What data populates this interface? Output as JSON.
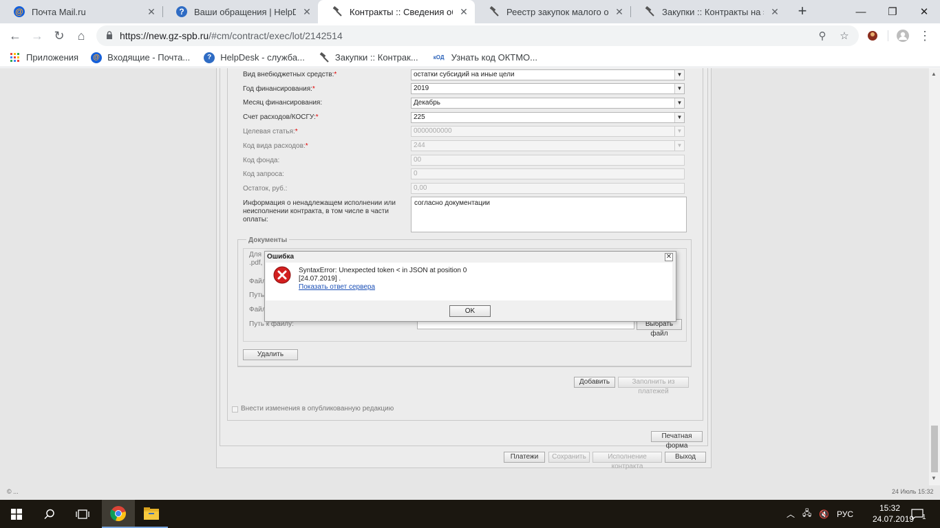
{
  "browser": {
    "tabs": [
      {
        "title": "Почта Mail.ru",
        "icon": "mail-ru-icon"
      },
      {
        "title": "Ваши обращения | HelpDesk",
        "icon": "helpdesk-icon"
      },
      {
        "title": "Контракты :: Сведения об исп",
        "icon": "gavel-icon",
        "active": true
      },
      {
        "title": "Реестр закупок малого объем",
        "icon": "gavel-icon"
      },
      {
        "title": "Закупки :: Контракты на этапе",
        "icon": "gavel-icon"
      }
    ],
    "new_tab": "+",
    "url_host": "https://new.gz-spb.ru",
    "url_path": "/#cm/contract/exec/lot/2142514",
    "bookmarks": [
      {
        "label": "Приложения",
        "icon": "apps-grid-icon"
      },
      {
        "label": "Входящие - Почта...",
        "icon": "mail-ru-icon"
      },
      {
        "label": "HelpDesk - служба...",
        "icon": "helpdesk-icon"
      },
      {
        "label": "Закупки :: Контрак...",
        "icon": "gavel-icon"
      },
      {
        "label": "Узнать код ОКТМО...",
        "icon": "kod-icon"
      }
    ]
  },
  "form": {
    "fields": [
      {
        "label": "Вид внебюджетных средств:",
        "required": true,
        "value": "остатки субсидий на иные цели",
        "dropdown": true,
        "disabled": false
      },
      {
        "label": "Год финансирования:",
        "required": true,
        "value": "2019",
        "dropdown": true,
        "disabled": false
      },
      {
        "label": "Месяц финансирования:",
        "required": false,
        "value": "Декабрь",
        "dropdown": true,
        "disabled": false
      },
      {
        "label": "Счет расходов/КОСГУ:",
        "required": true,
        "value": "225",
        "dropdown": true,
        "disabled": false
      },
      {
        "label": "Целевая статья:",
        "required": true,
        "value": "0000000000",
        "dropdown": true,
        "disabled": true
      },
      {
        "label": "Код вида расходов:",
        "required": true,
        "value": "244",
        "dropdown": true,
        "disabled": true
      },
      {
        "label": "Код фонда:",
        "required": false,
        "value": "00",
        "dropdown": false,
        "disabled": true
      },
      {
        "label": "Код запроса:",
        "required": false,
        "value": "0",
        "dropdown": false,
        "disabled": true
      },
      {
        "label": "Остаток, руб.:",
        "required": false,
        "value": "0,00",
        "dropdown": false,
        "disabled": true
      }
    ],
    "info_label": "Информация о ненадлежащем исполнении или неисполнении контракта, в том числе в части оплаты:",
    "info_value": "согласно документации",
    "documents": {
      "legend": "Документы",
      "hint_partial_1": "Для",
      "hint_partial_2": ".pdf,",
      "file_label_partial": "Файл",
      "path_label_partial": "Путь",
      "file_label_partial_2": "Файл",
      "path_label": "Путь к файлу:",
      "choose_file": "Выбрать файл",
      "delete": "Удалить"
    },
    "add_button": "Добавить",
    "fill_from_payments": "Заполнить из платежей",
    "publish_checkbox": "Внести изменения в опубликованную редакцию",
    "print_form": "Печатная форма",
    "bottom_buttons": [
      "Платежи",
      "Сохранить",
      "Исполнение контракта",
      "Выход"
    ]
  },
  "dialog": {
    "title": "Ошибка",
    "message_line1": "SyntaxError: Unexpected token < in JSON at position 0",
    "message_line2": "[24.07.2019] .",
    "link": "Показать ответ сервера",
    "ok": "OK"
  },
  "status": {
    "left": "© ...",
    "right": "24 Июль 15:32"
  },
  "taskbar": {
    "language": "РУС",
    "time": "15:32",
    "date": "24.07.2019",
    "notifications": "1"
  }
}
